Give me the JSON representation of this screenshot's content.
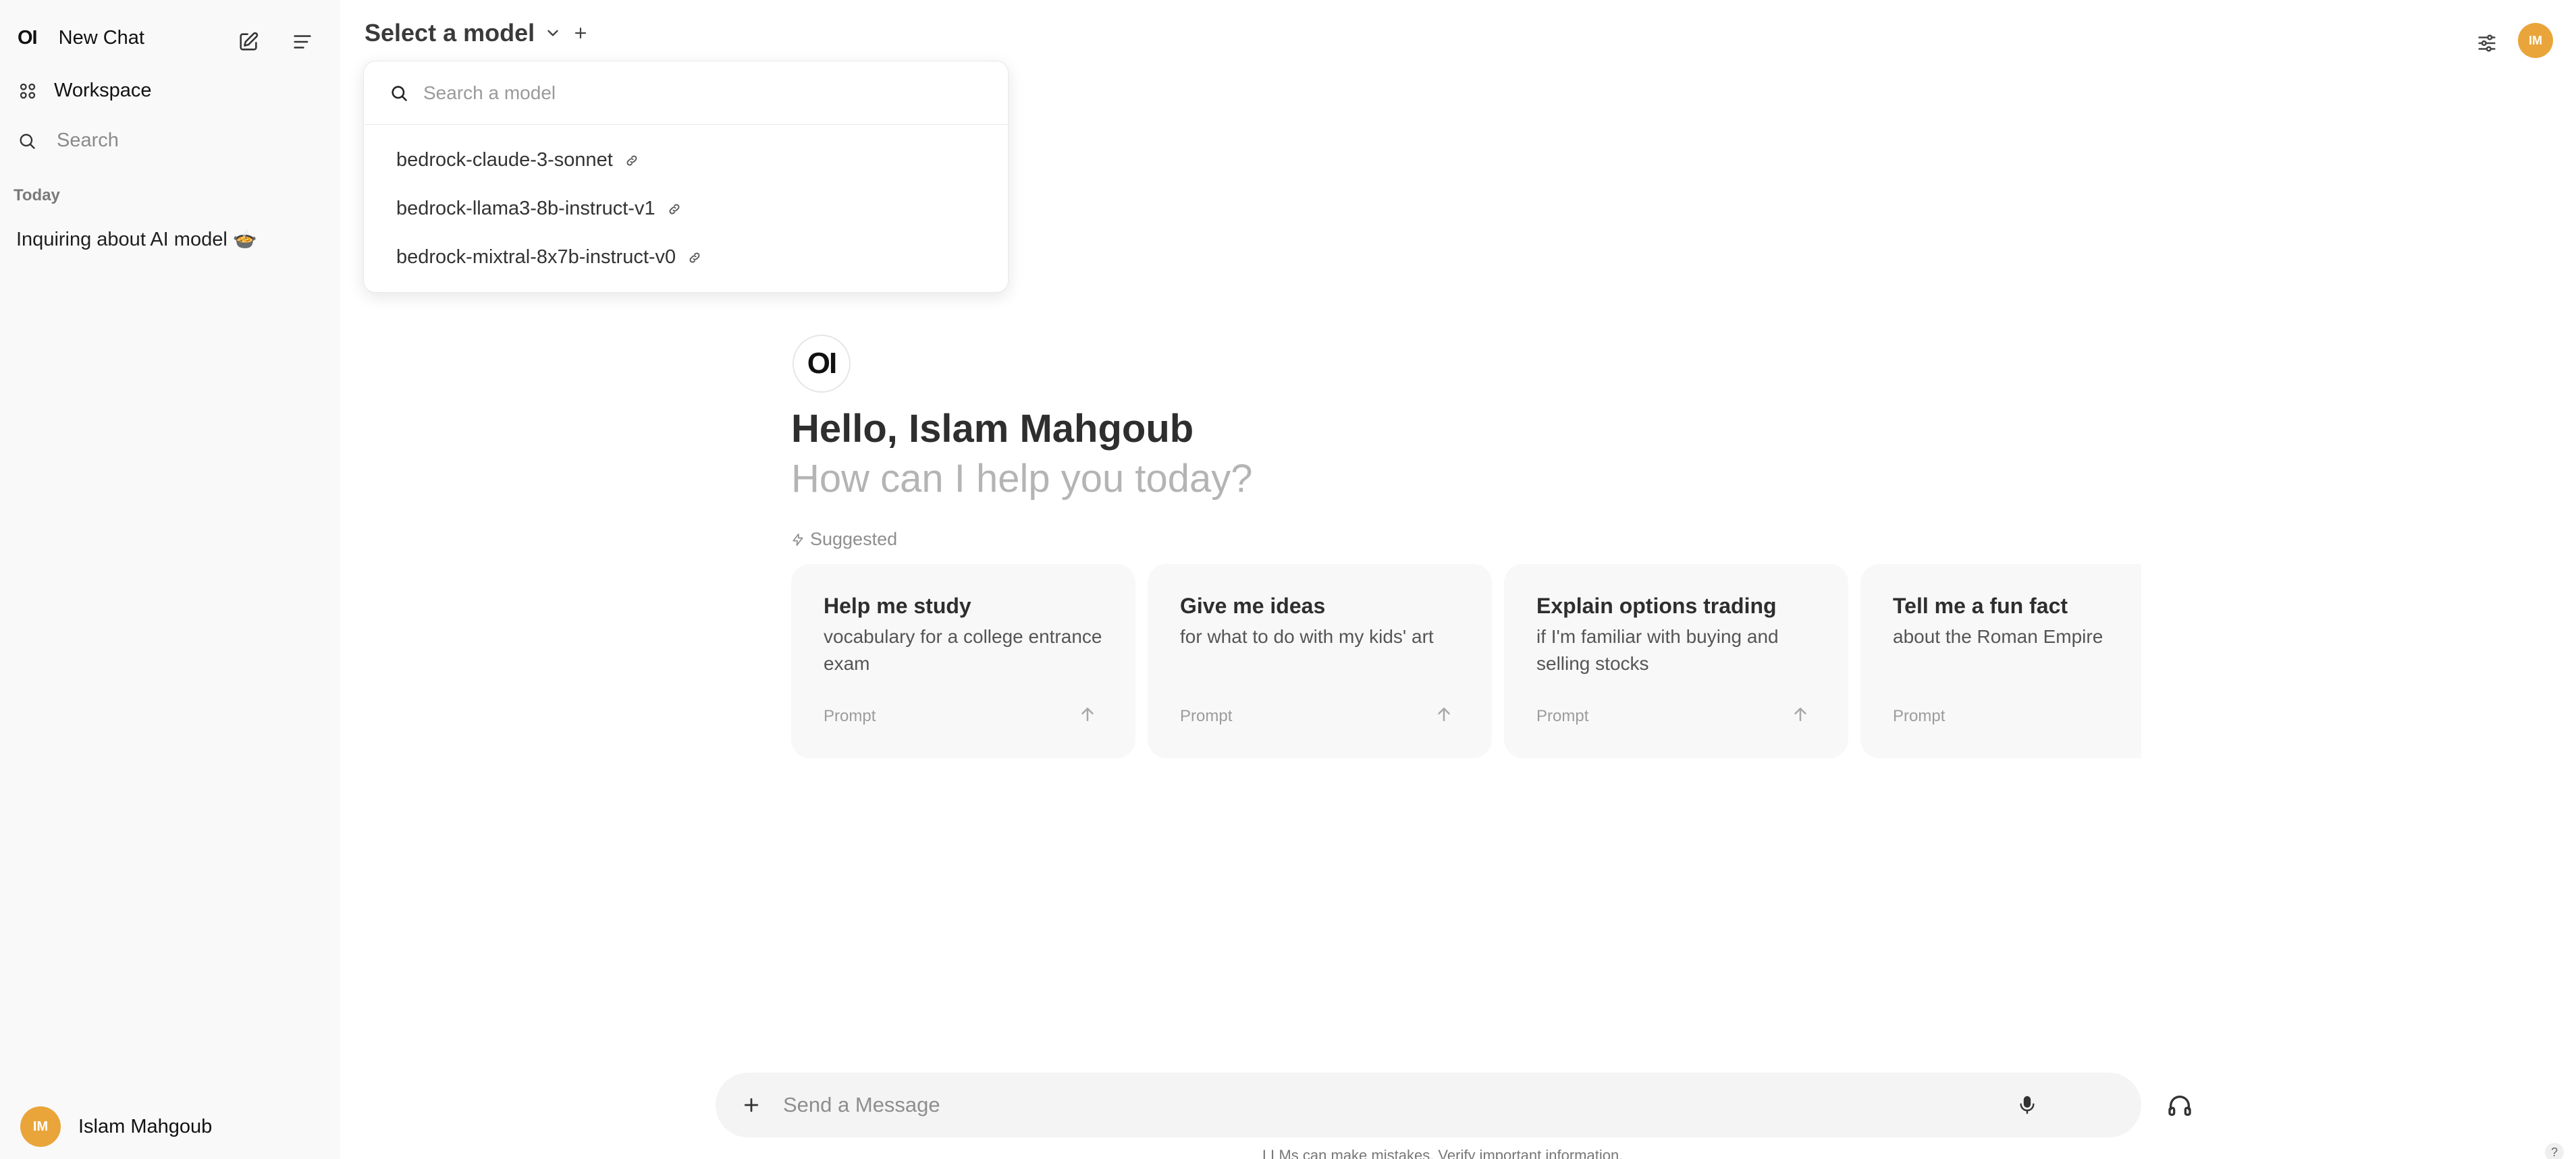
{
  "sidebar": {
    "logo": "OI",
    "new_chat": "New Chat",
    "workspace": "Workspace",
    "search_placeholder": "Search",
    "section_today": "Today",
    "chats": [
      {
        "title": "Inquiring about AI model 🍲"
      }
    ],
    "user": {
      "initials": "IM",
      "name": "Islam Mahgoub"
    }
  },
  "header": {
    "model_select_label": "Select a model",
    "avatar_initials": "IM"
  },
  "model_dropdown": {
    "search_placeholder": "Search a model",
    "models": [
      {
        "name": "bedrock-claude-3-sonnet",
        "icon": "link-icon"
      },
      {
        "name": "bedrock-llama3-8b-instruct-v1",
        "icon": "link-icon"
      },
      {
        "name": "bedrock-mixtral-8x7b-instruct-v0",
        "icon": "link-icon"
      }
    ]
  },
  "main": {
    "logo": "OI",
    "greeting": "Hello, Islam Mahgoub",
    "subgreeting": "How can I help you today?",
    "suggested_label": "Suggested",
    "suggestions": [
      {
        "title": "Help me study",
        "subtitle": "vocabulary for a college entrance exam",
        "tag": "Prompt"
      },
      {
        "title": "Give me ideas",
        "subtitle": "for what to do with my kids' art",
        "tag": "Prompt"
      },
      {
        "title": "Explain options trading",
        "subtitle": "if I'm familiar with buying and selling stocks",
        "tag": "Prompt"
      },
      {
        "title": "Tell me a fun fact",
        "subtitle": "about the Roman Empire",
        "tag": "Prompt"
      }
    ]
  },
  "composer": {
    "placeholder": "Send a Message",
    "disclaimer": "LLMs can make mistakes. Verify important information.",
    "help": "?"
  },
  "colors": {
    "accent_avatar": "#e9a53a",
    "sidebar_bg": "#f9f9f9",
    "card_bg": "#f8f8f8"
  }
}
